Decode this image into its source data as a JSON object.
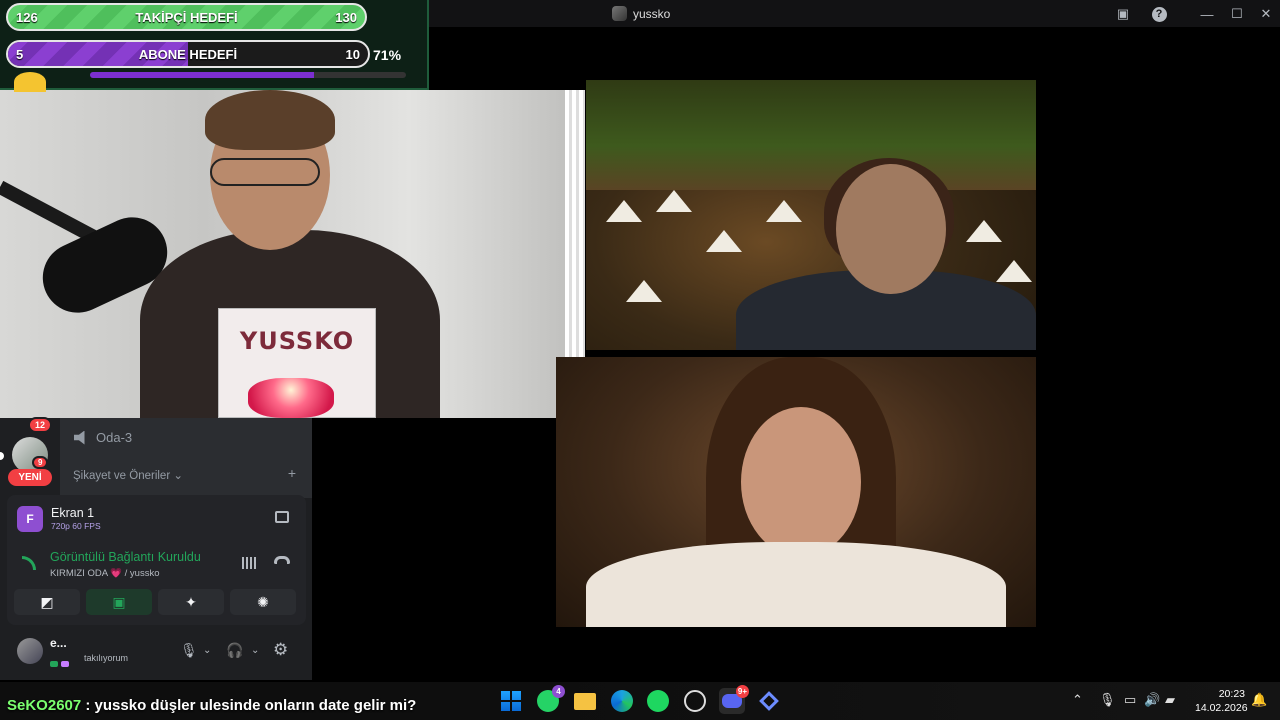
{
  "window": {
    "title": "yussko",
    "icons": [
      "screen-share-icon",
      "help-icon",
      "minimize-icon",
      "maximize-icon",
      "close-icon"
    ]
  },
  "goals": {
    "follower": {
      "current": "126",
      "label": "TAKİPÇİ HEDEFİ",
      "target": "130",
      "fill_fraction": 0.97
    },
    "subscriber": {
      "current": "5",
      "label": "ABONE HEDEFİ",
      "target": "10",
      "fill_fraction": 0.5
    },
    "percent": "71%",
    "mini_bar_fraction": 0.71
  },
  "video": {
    "sign_text": "YUSSKO"
  },
  "rail": {
    "avatar_badge": "12",
    "second_badge": "9",
    "new_label": "YENİ"
  },
  "channels": {
    "voice_channel": "Oda-3",
    "category": "Şikayet ve Öneriler",
    "category_chevron": "⌄",
    "add_symbol": "+"
  },
  "voice": {
    "screen_icon_letter": "F",
    "screen_name": "Ekran 1",
    "screen_meta": "720p 60 FPS",
    "status": "Görüntülü Bağlantı Kuruldu",
    "room": "KIRMIZI ODA 💗 / yussko",
    "actions": [
      "camera-off-icon",
      "share-screen-icon",
      "activities-icon",
      "soundboard-icon"
    ]
  },
  "user": {
    "name": "e...",
    "status": "takılıyorum"
  },
  "chat": {
    "username": "SeKO2607",
    "message": ": yussko düşler ulesinde onların date gelir mi?"
  },
  "taskbar": {
    "apps": [
      "windows-start-icon",
      "whatsapp-icon",
      "file-explorer-icon",
      "edge-icon",
      "spotify-icon",
      "chatgpt-icon",
      "discord-icon",
      "app-icon"
    ],
    "whatsapp_badge": "4",
    "discord_badge": "9+",
    "time": "20:23",
    "date": "14.02.2026"
  },
  "colors": {
    "follower_green": "#5fd06c",
    "subscriber_purple": "#8b3fd1",
    "discord_green": "#23a55a",
    "chat_user_green": "#7bff6f",
    "badge_red": "#f23f43"
  }
}
